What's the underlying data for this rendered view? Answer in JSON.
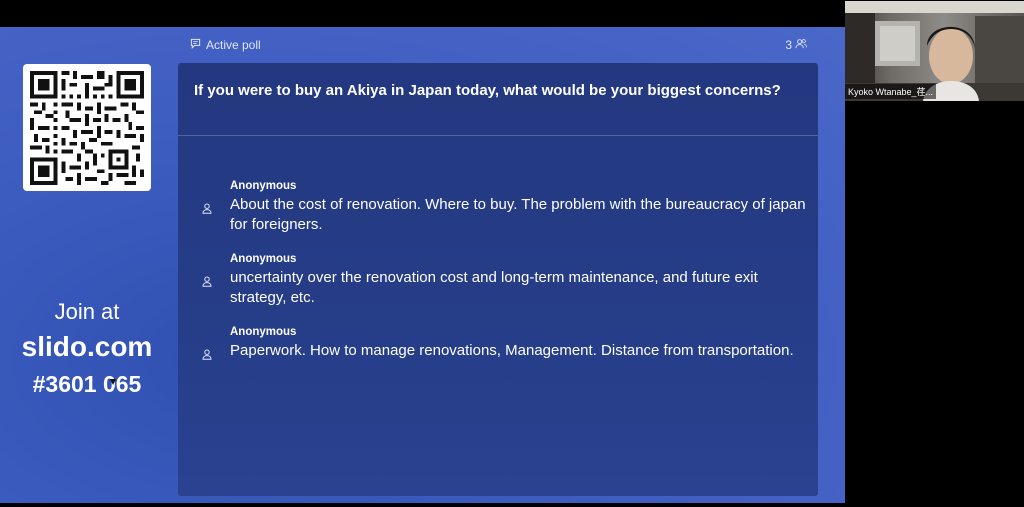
{
  "poll": {
    "status_label": "Active poll",
    "participant_count": "3",
    "question": "If you were to buy an Akiya in Japan today, what would be your biggest concerns?"
  },
  "join": {
    "line": "Join at",
    "domain": "slido.com",
    "code": "#3601 065"
  },
  "responses": [
    {
      "author": "Anonymous",
      "text": "About the cost of renovation. Where to buy. The problem with the bureaucracy of japan for foreigners."
    },
    {
      "author": "Anonymous",
      "text": "uncertainty over the renovation cost and long-term maintenance, and future exit strategy, etc."
    },
    {
      "author": "Anonymous",
      "text": "Paperwork. How to manage renovations, Management. Distance from transportation."
    }
  ],
  "participant": {
    "name": "Kyoko Wtanabe_荏..."
  },
  "colors": {
    "background": "#3d5cc0",
    "panel": "#263d88",
    "text": "#ffffff"
  },
  "icons": [
    "chat-icon",
    "people-icon",
    "user-icon",
    "qr-code"
  ]
}
